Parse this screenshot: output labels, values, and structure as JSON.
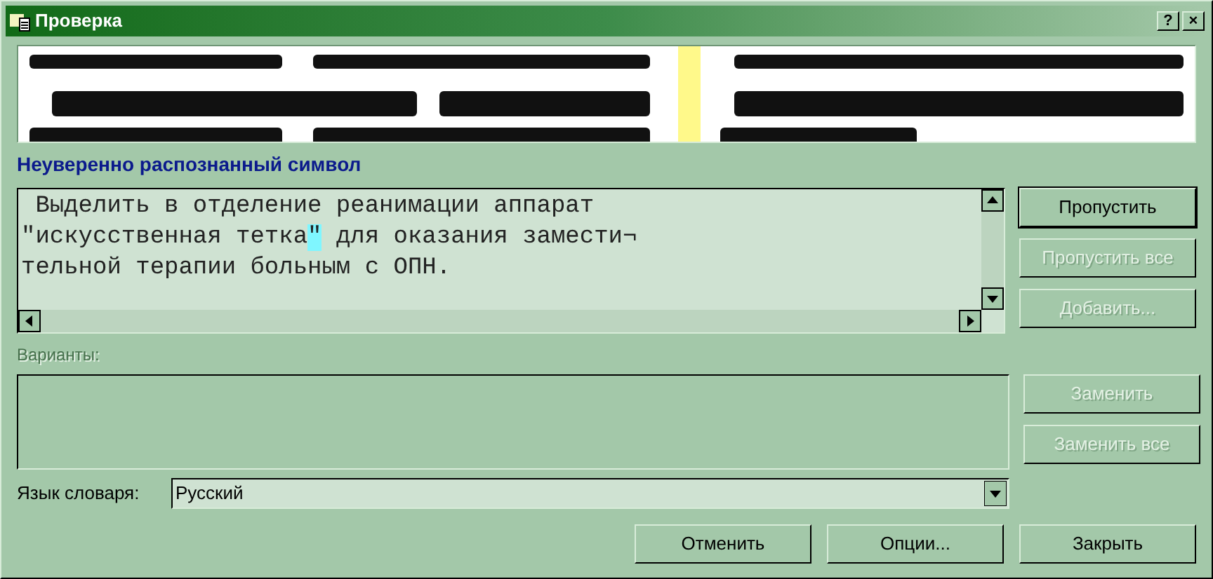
{
  "window": {
    "title": "Проверка",
    "controls": [
      "?",
      "×"
    ]
  },
  "section_title": "Неуверенно распознанный символ",
  "editor": {
    "lines": [
      [
        {
          "text": " Выделить в отделение реанимации аппарат",
          "highlighted": false
        }
      ],
      [
        {
          "text": "\"искусственная тетка",
          "highlighted": false
        },
        {
          "text": "\"",
          "highlighted": true
        },
        {
          "text": " для оказания замести¬",
          "highlighted": false
        }
      ],
      [
        {
          "text": "тельной терапии больным с ОПН.",
          "highlighted": false
        }
      ]
    ]
  },
  "side_buttons": [
    {
      "label": "Пропустить",
      "disabled": false,
      "default": true
    },
    {
      "label": "Пропустить все",
      "disabled": true,
      "default": false
    },
    {
      "label": "Добавить...",
      "disabled": true,
      "default": false
    }
  ],
  "variants": {
    "label": "Варианты:",
    "disabled": true
  },
  "replace_buttons": [
    {
      "label": "Заменить",
      "disabled": true
    },
    {
      "label": "Заменить все",
      "disabled": true
    }
  ],
  "language": {
    "label": "Язык словаря:",
    "value": "Русский"
  },
  "bottom_buttons": [
    {
      "label": "Отменить",
      "disabled": false
    },
    {
      "label": "Опции...",
      "disabled": false
    },
    {
      "label": "Закрыть",
      "disabled": false
    }
  ]
}
